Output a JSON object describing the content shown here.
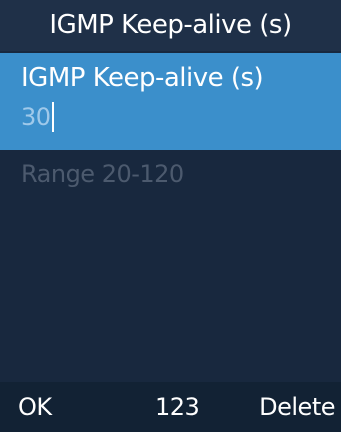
{
  "header": {
    "title": "IGMP Keep-alive (s)"
  },
  "field": {
    "label": "IGMP Keep-alive (s)",
    "value": "30"
  },
  "hint": "Range 20-120",
  "softkeys": {
    "left": "OK",
    "center": "123",
    "right": "Delete"
  },
  "colors": {
    "background": "#18283e",
    "header": "#1f3048",
    "selected_field": "#3b8fcb",
    "hint_text": "#4c5a6e",
    "softkey_bar": "#122234"
  }
}
